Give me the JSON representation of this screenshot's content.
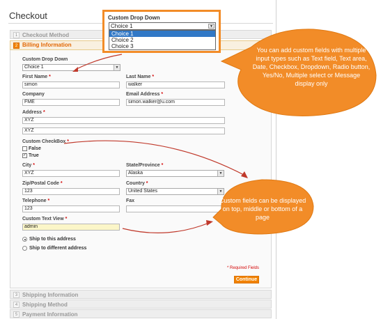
{
  "page": {
    "title": "Checkout"
  },
  "steps": [
    {
      "num": "1",
      "label": "Checkout Method"
    },
    {
      "num": "2",
      "label": "Billing Information"
    },
    {
      "num": "3",
      "label": "Shipping Information"
    },
    {
      "num": "4",
      "label": "Shipping Method"
    },
    {
      "num": "5",
      "label": "Payment Information"
    }
  ],
  "form": {
    "custom_dropdown": {
      "label": "Custom Drop Down",
      "value": "Choice 1"
    },
    "first_name": {
      "label": "First Name",
      "value": "simon"
    },
    "last_name": {
      "label": "Last Name",
      "value": "walker"
    },
    "company": {
      "label": "Company",
      "value": "FME"
    },
    "email": {
      "label": "Email Address",
      "value": "simon.walker@u.com"
    },
    "address": {
      "label": "Address",
      "line1": "XYZ",
      "line2": "XYZ"
    },
    "custom_checkbox": {
      "label": "Custom CheckBox",
      "opt_false": "False",
      "opt_true": "True",
      "checked": "True"
    },
    "city": {
      "label": "City",
      "value": "XYZ"
    },
    "state": {
      "label": "State/Province",
      "value": "Alaska"
    },
    "zip": {
      "label": "Zip/Postal Code",
      "value": "123"
    },
    "country": {
      "label": "Country",
      "value": "United States"
    },
    "telephone": {
      "label": "Telephone",
      "value": "123"
    },
    "fax": {
      "label": "Fax",
      "value": ""
    },
    "custom_text_view": {
      "label": "Custom Text View",
      "value": "admin"
    },
    "ship_same": "Ship to this address",
    "ship_different": "Ship to different address",
    "required_note": "* Required Fields",
    "continue": "Continue",
    "req_mark": "*"
  },
  "zoom": {
    "title": "Custom Drop Down",
    "selected": "Choice 1",
    "options": [
      "Choice 1",
      "Choice 2",
      "Choice 3"
    ]
  },
  "callouts": {
    "one": "You can add custom fields with multiple input types such as Text field, Text area, Date, Checkbox, Dropdown, Radio button, Yes/No, Multiple select or Message display only",
    "two": "Custom fields can be displayed on top, middle or bottom of a page"
  },
  "colors": {
    "accent": "#f18200",
    "bubble": "#f28c28",
    "highlight": "#3178c6",
    "required": "#d40707"
  }
}
